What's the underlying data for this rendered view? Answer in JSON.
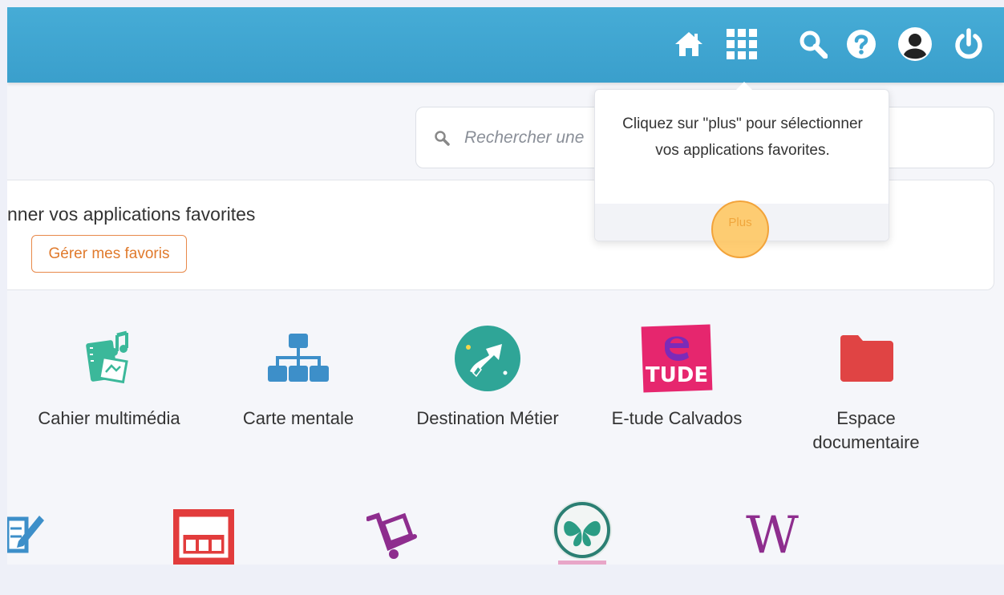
{
  "header": {
    "icons": [
      "home-icon",
      "apps-grid-icon",
      "search-icon",
      "help-icon",
      "user-icon",
      "power-icon"
    ]
  },
  "search": {
    "placeholder": "Rechercher une"
  },
  "favorites": {
    "title": "nner vos applications favorites",
    "manage_button": "Gérer mes favoris"
  },
  "tooltip": {
    "message": "Cliquez sur \"plus\" pour sélectionner vos applications favorites.",
    "plus_button": "Plus"
  },
  "apps_row1": [
    {
      "label": "Cahier multimédia",
      "icon": "music-notebook-icon"
    },
    {
      "label": "Carte mentale",
      "icon": "org-chart-icon"
    },
    {
      "label": "Destination Métier",
      "icon": "destination-arrow-icon"
    },
    {
      "label": "E-tude Calvados",
      "icon": "etude-logo-icon"
    },
    {
      "label": "Espace documentaire",
      "icon": "folder-icon"
    }
  ],
  "apps_row2_icons": [
    "pencil-form-icon",
    "layout-window-icon",
    "trolley-icon",
    "pronote-butterfly-icon",
    "wikipedia-w-icon"
  ],
  "colors": {
    "header_blue": "#3fa6d2",
    "accent_orange": "#e07a2c",
    "teal": "#3bb89a",
    "app_blue": "#3d8fc9",
    "etude_pink": "#e6266e",
    "folder_red": "#e04444",
    "wiki_purple": "#8e2d8e"
  }
}
